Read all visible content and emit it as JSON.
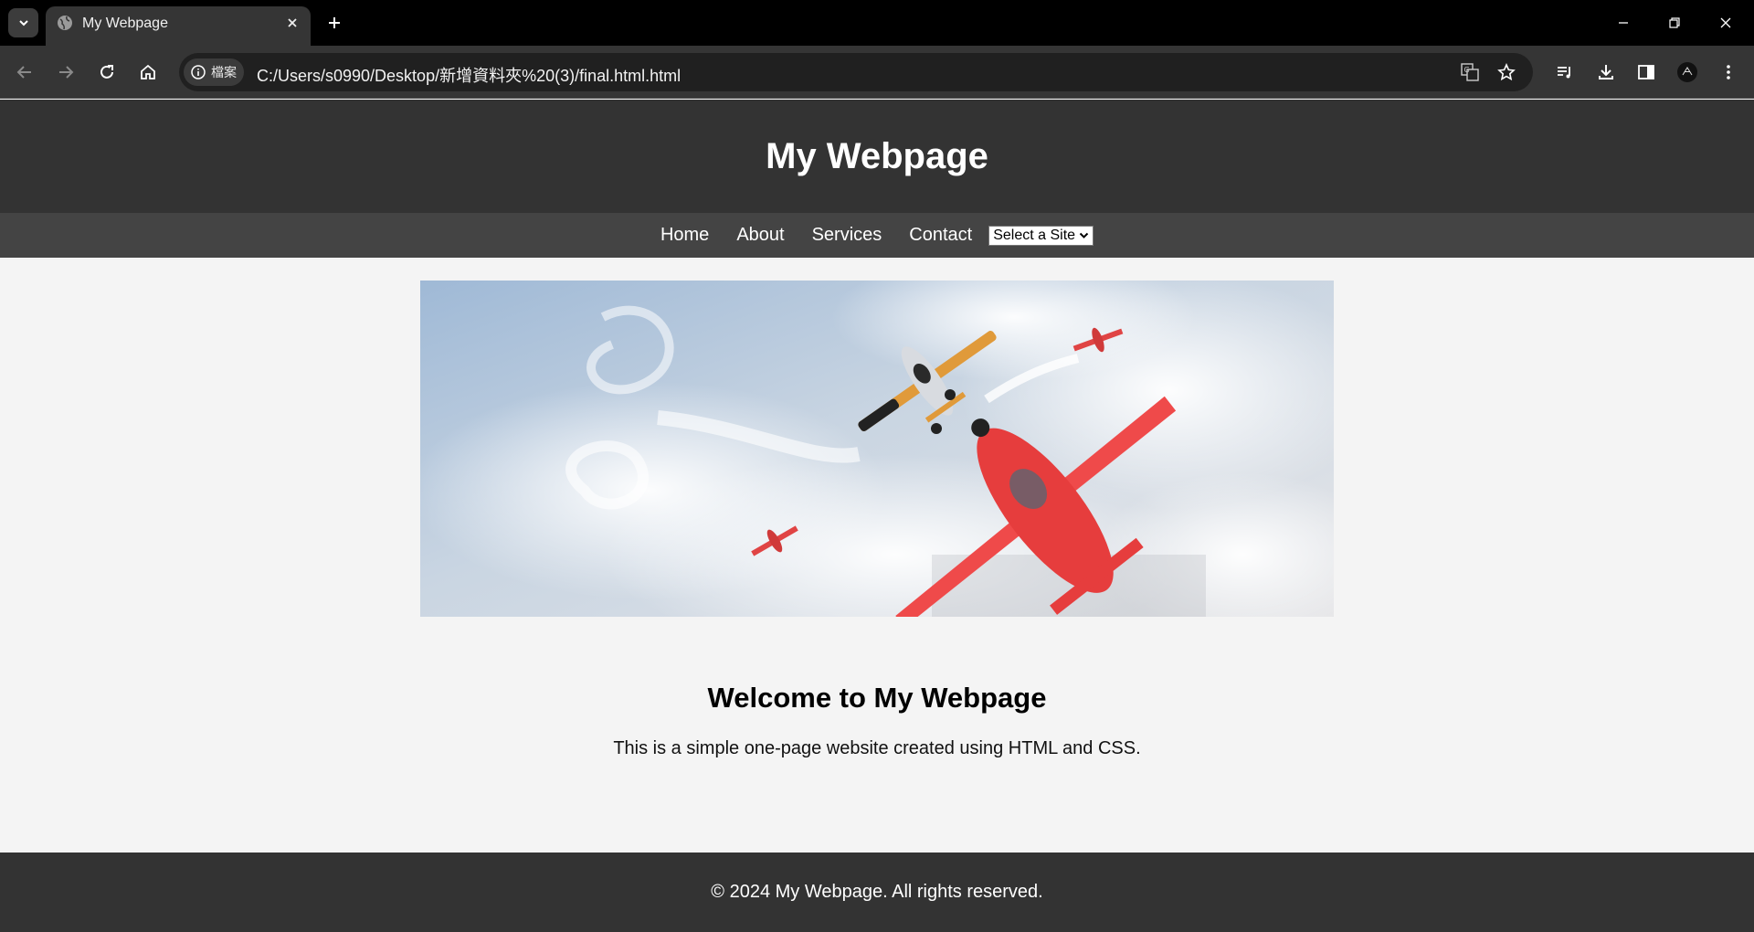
{
  "browser": {
    "tab_title": "My Webpage",
    "site_chip_label": "檔案",
    "url": "C:/Users/s0990/Desktop/新增資料夾%20(3)/final.html.html"
  },
  "page": {
    "header_title": "My Webpage",
    "nav": {
      "home": "Home",
      "about": "About",
      "services": "Services",
      "contact": "Contact",
      "select_value": "Select a Site"
    },
    "hero_image_icon": "airplanes-in-sky-image",
    "welcome_heading": "Welcome to My Webpage",
    "intro_text": "This is a simple one-page website created using HTML and CSS.",
    "footer_text": "© 2024 My Webpage. All rights reserved."
  },
  "colors": {
    "header_bg": "#333333",
    "nav_bg": "#444444",
    "page_bg": "#f4f4f4",
    "footer_bg": "#333333"
  }
}
